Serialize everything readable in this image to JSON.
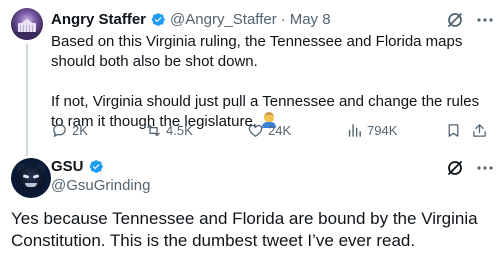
{
  "tweet": {
    "author": {
      "name": "Angry Staffer",
      "handle": "@Angry_Staffer",
      "date": "May 8"
    },
    "text_p1": "Based on this Virginia ruling, the Tennessee and Florida maps should both also be shot down.",
    "text_p2": "If not, Virginia should just pull a Tennessee and change the rules to ram it though the legislature.",
    "emoji": "man-shrugging",
    "stats": {
      "replies": "2K",
      "retweets": "4.5K",
      "likes": "24K",
      "views": "794K"
    }
  },
  "reply": {
    "author": {
      "name": "GSU",
      "handle": "@GsuGrinding"
    },
    "text": "Yes because Tennessee and Florida are bound by the Virginia Constitution. This is the dumbest tweet I’ve ever read."
  },
  "colors": {
    "verified": "#1d9bf0",
    "muted": "#536471",
    "text": "#0f1419",
    "thread_line": "#cfd9de"
  }
}
